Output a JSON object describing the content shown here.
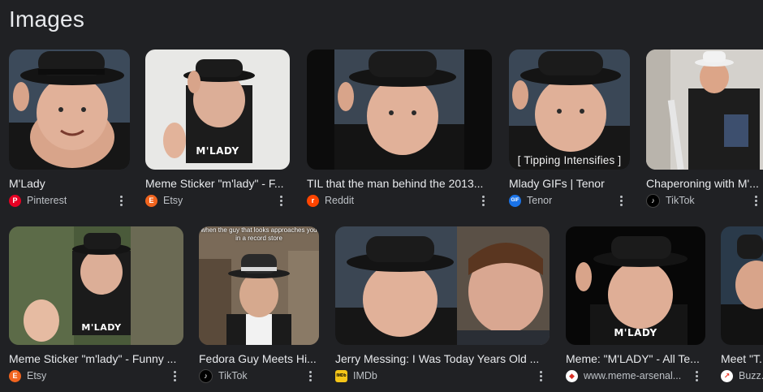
{
  "section_title": "Images",
  "row1": [
    {
      "caption": "M'Lady",
      "source": "Pinterest",
      "favicon": {
        "letter": "P",
        "color": "#e60023"
      }
    },
    {
      "caption": "Meme Sticker \"m'lady\" - F...",
      "source": "Etsy",
      "favicon": {
        "letter": "E",
        "color": "#f1641e"
      },
      "overlay": "M'LADY"
    },
    {
      "caption": "TIL that the man behind the 2013...",
      "source": "Reddit",
      "favicon": {
        "letter": "r",
        "color": "#ff4500"
      }
    },
    {
      "caption": "Mlady GIFs | Tenor",
      "source": "Tenor",
      "favicon": {
        "letter": "GIF",
        "color": "#1a73e8"
      },
      "overlay": "[ Tipping Intensifies ]"
    },
    {
      "caption": "Chaperoning with M'...",
      "source": "TikTok",
      "favicon": {
        "letter": "♪",
        "color": "#000000"
      }
    }
  ],
  "row2": [
    {
      "caption": "Meme Sticker \"m'lady\" - Funny ...",
      "source": "Etsy",
      "favicon": {
        "letter": "E",
        "color": "#f1641e"
      },
      "overlay": "M'LADY"
    },
    {
      "caption": "Fedora Guy Meets Hi...",
      "source": "TikTok",
      "favicon": {
        "letter": "♪",
        "color": "#000000"
      },
      "overlay": "when the guy that looks approaches you in a record store"
    },
    {
      "caption": "Jerry Messing: I Was Today Years Old ...",
      "source": "IMDb",
      "favicon": {
        "letter": "IMDb",
        "color": "#f5c518"
      }
    },
    {
      "caption": "Meme: \"M'LADY\" - All Te...",
      "source": "www.meme-arsenal...",
      "favicon": {
        "letter": "◆",
        "color": "#d93025"
      },
      "overlay": "M'LADY"
    },
    {
      "caption": "Meet \"T...",
      "source": "Buzz...",
      "favicon": {
        "letter": "↗",
        "color": "#ee3322"
      }
    }
  ]
}
